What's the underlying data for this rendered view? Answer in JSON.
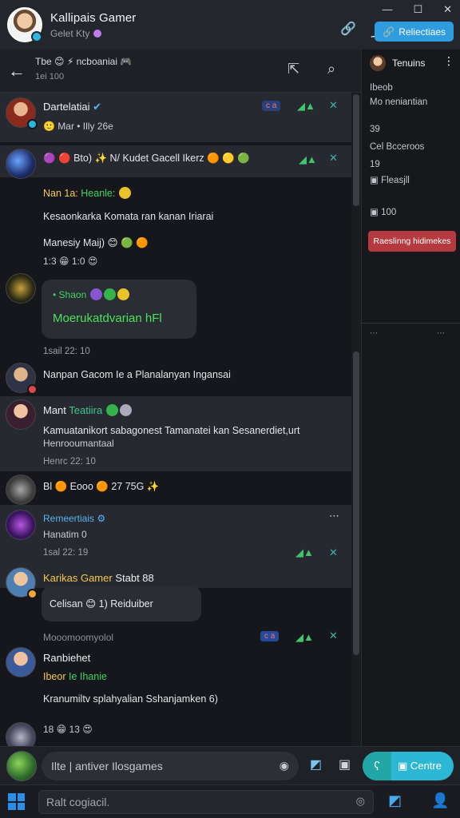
{
  "window": {
    "title": "Kallipais Gamer",
    "subtitle": "Gelet Kty",
    "controls": [
      "—",
      "☐",
      "✕"
    ],
    "button_label": "Reliectiaes"
  },
  "channel": {
    "name": "Tbe 😊 ⚡ ncboaniai 🎮",
    "meta": "1ei 100"
  },
  "messages": [
    {
      "user": "Dartelatiai",
      "text": "🙂 Mar • Illy 26e",
      "tag": "c a"
    },
    {
      "text": "🟣 🔴 Bto) ✨ N/ Kudet Gacell Ikerz 🟠 🟡 🟢"
    },
    {
      "label_a": "Nan 1a:",
      "label_b": "Heanle:",
      "line1": "Kesaonkarka Komata ran kanan Iriarai",
      "line2": "Manesiy Maij) 😊 🟢 🟠"
    },
    {
      "meta": "1:3 😁 1:0 😍"
    },
    {
      "bubble_a": "Shaon",
      "bubble_b": "Moerukatdvarian hFl",
      "time": "1sail 22: 10"
    },
    {
      "text": "Nanpan Gacom Ie a Planalanyan Ingansai"
    },
    {
      "user": "Mant",
      "user2": "Teatiira",
      "line1": "Kamuatanikort sabagonest Tamanatei kan Sesanerdiet,urt",
      "line2": "Henrooumantaal",
      "time": "Henrc 22: 10"
    },
    {
      "text": "Bl 🟠 Eooo 🟠 27 75G ✨"
    },
    {
      "user": "Remeertiais",
      "meta": "Hanatim 0",
      "time": "1sal 22: 19"
    },
    {
      "user": "Karikas Gamer",
      "user2": "Stabt 88",
      "bubble": "Celisan 😊 1) Reiduiber"
    },
    {
      "meta": "Mooomoomyolol"
    },
    {
      "user": "Ranbiehet",
      "line1": "Ibeor",
      "line2": "Ie Ihanie",
      "text": "Kranumiltv splahyalian Sshanjamken 6)"
    },
    {
      "meta": "18 😁 13 😍"
    }
  ],
  "side_panel": {
    "user": "Tenuins",
    "lines": [
      "Ibeob",
      "Mo neniantian",
      "39",
      "Cel Bcceroos",
      "19",
      "Fleasjll"
    ],
    "count": "100",
    "button": "Raeslinng hidimekes"
  },
  "composer": {
    "placeholder": "Ilte | antiver Ilosgames",
    "send_label": "Centre"
  },
  "taskbar": {
    "search_placeholder": "Ralt cogiacil."
  }
}
